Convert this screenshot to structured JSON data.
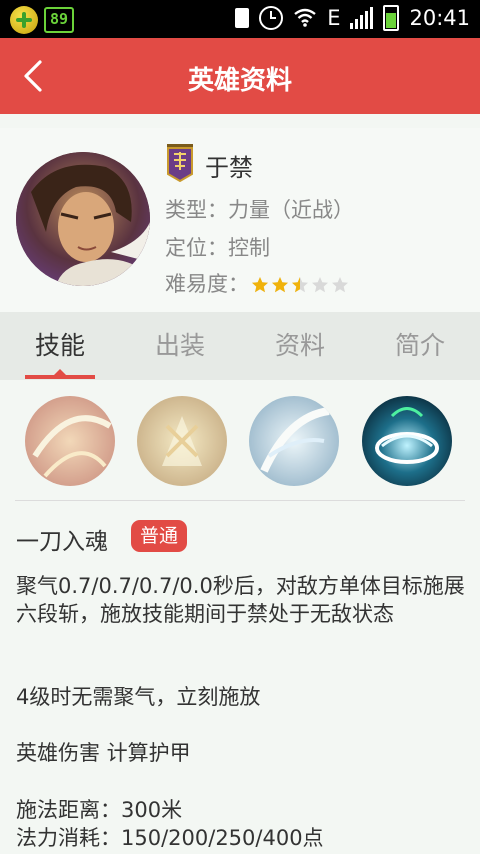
{
  "status_bar": {
    "battery_badge": "89",
    "time": "20:41",
    "network_label": "E"
  },
  "app_bar": {
    "title": "英雄资料"
  },
  "hero": {
    "name": "于禁",
    "type_label": "类型：",
    "type_value": "力量（近战）",
    "position_label": "定位：",
    "position_value": "控制",
    "difficulty_label": "难易度：",
    "difficulty_rating": 2.5,
    "difficulty_max": 5
  },
  "tabs": [
    {
      "label": "技能",
      "active": true
    },
    {
      "label": "出装",
      "active": false
    },
    {
      "label": "资料",
      "active": false
    },
    {
      "label": "简介",
      "active": false
    }
  ],
  "skill_icons": [
    "skill-1-icon",
    "skill-2-icon",
    "skill-3-icon",
    "skill-4-icon"
  ],
  "selected_skill": {
    "name": "一刀入魂",
    "tag": "普通",
    "description_1": "聚气0.7/0.7/0.7/0.0秒后，对敌方单体目标施展六段斩，施放技能期间于禁处于无敌状态",
    "description_2": "4级时无需聚气，立刻施放",
    "description_3": "英雄伤害 计算护甲",
    "range": "施法距离：300米",
    "cost": "法力消耗：150/200/250/400点"
  },
  "colors": {
    "accent": "#e24b45",
    "background": "#f3f7f3",
    "star_filled": "#f0b20a",
    "star_empty": "#d9d9d9"
  }
}
